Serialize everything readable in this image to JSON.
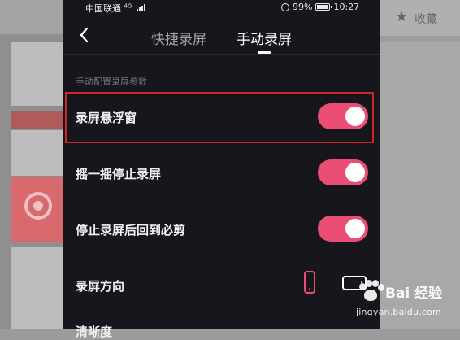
{
  "status_bar": {
    "carrier": "中国联通",
    "network": "4G",
    "battery": "99%",
    "time": "10:27"
  },
  "background_page": {
    "favorite_label": "收藏"
  },
  "nav": {
    "tabs": [
      {
        "label": "快捷录屏",
        "active": false
      },
      {
        "label": "手动录屏",
        "active": true
      }
    ]
  },
  "section_title": "手动配置录屏参数",
  "settings": [
    {
      "label": "录屏悬浮窗",
      "enabled": true,
      "highlighted": true
    },
    {
      "label": "摇一摇停止录屏",
      "enabled": true
    },
    {
      "label": "停止录屏后回到必剪",
      "enabled": true
    }
  ],
  "orientation": {
    "label": "录屏方向",
    "options": [
      "portrait",
      "landscape"
    ],
    "selected": "portrait"
  },
  "partial_row_label": "清晰度",
  "watermark": {
    "brand": "Bai 经验",
    "url": "jingyan.baidu.com"
  },
  "colors": {
    "accent": "#ea4e74",
    "highlight_border": "#d0242b",
    "phone_bg": "#17161c"
  }
}
